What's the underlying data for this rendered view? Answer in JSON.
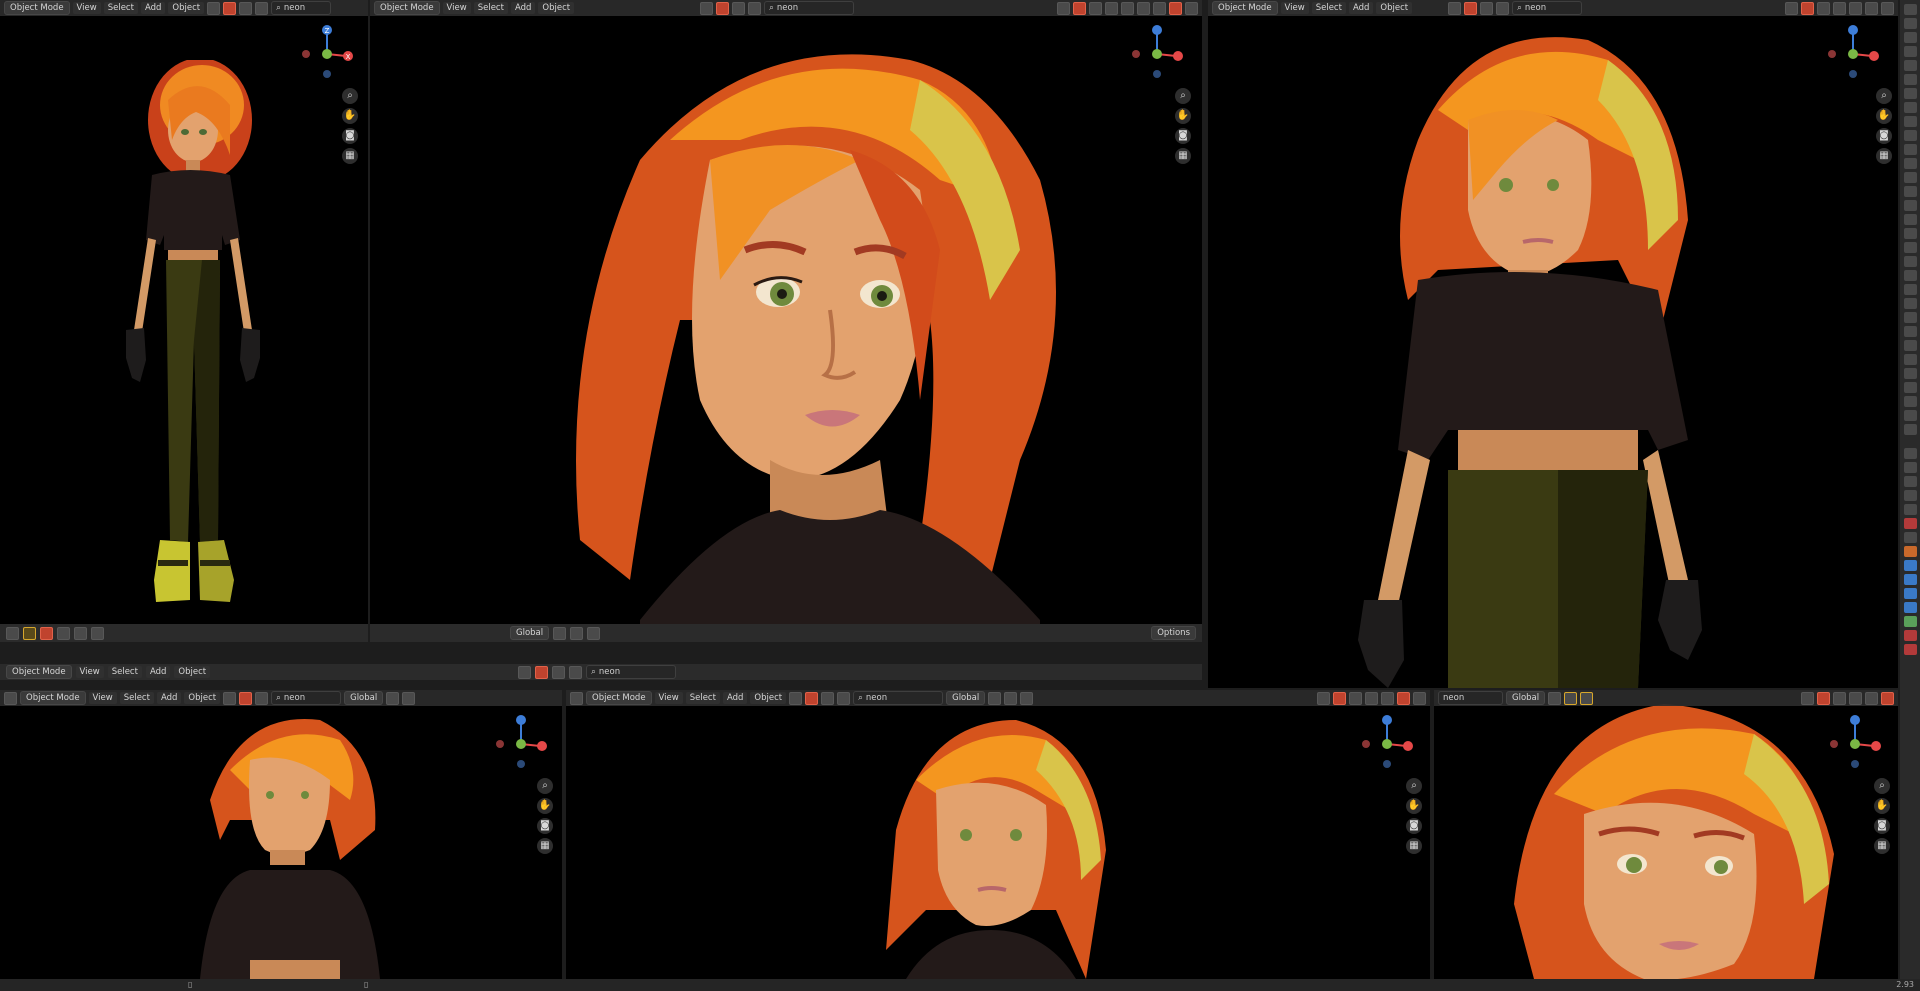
{
  "header": {
    "mode_label": "Object Mode",
    "menus": [
      "View",
      "Select",
      "Add",
      "Object"
    ],
    "search_value": "neon"
  },
  "toolbar_bottom": {
    "orientation": "Global",
    "options_label": "Options"
  },
  "statusbar": {
    "version": "2.93"
  },
  "gizmo_axes": {
    "x": "X",
    "y": "Y",
    "z": "Z"
  },
  "colors": {
    "background": "#000000",
    "header": "#2b2b2b",
    "hair_orange": "#e8731c",
    "skin": "#e3a26e",
    "shirt": "#231a19",
    "pants": "#3a3a12",
    "axis_x": "#e54848",
    "axis_y": "#7ab845",
    "axis_z": "#3d7dd8"
  },
  "icons": [
    "hand-icon",
    "zoom-icon",
    "camera-icon",
    "grid-icon",
    "cursor-icon"
  ]
}
